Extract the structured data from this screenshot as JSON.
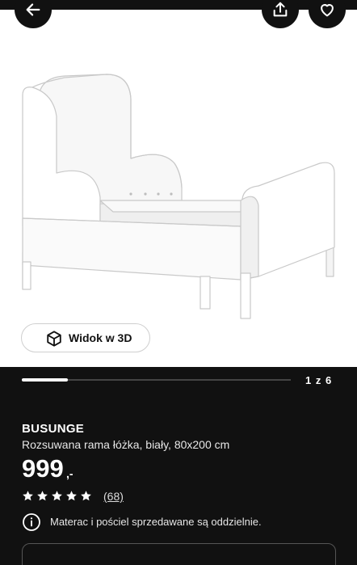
{
  "header": {
    "back_icon": "arrow-left-icon",
    "share_icon": "share-icon",
    "favorite_icon": "heart-icon"
  },
  "gallery": {
    "view_3d_label": "Widok w 3D",
    "view_3d_icon": "cube-icon",
    "pager_text": "1 z 6",
    "progress": 0.17
  },
  "product": {
    "name": "BUSUNGE",
    "description": "Rozsuwana rama łóżka, biały, 80x200 cm",
    "price": "999",
    "price_suffix": ",-",
    "rating_stars": 5,
    "review_count": "(68)",
    "notice": "Materac i pościel sprzedawane są oddzielnie."
  },
  "colors": {
    "background": "#111111",
    "hero_background": "#ffffff",
    "text": "#ffffff"
  }
}
